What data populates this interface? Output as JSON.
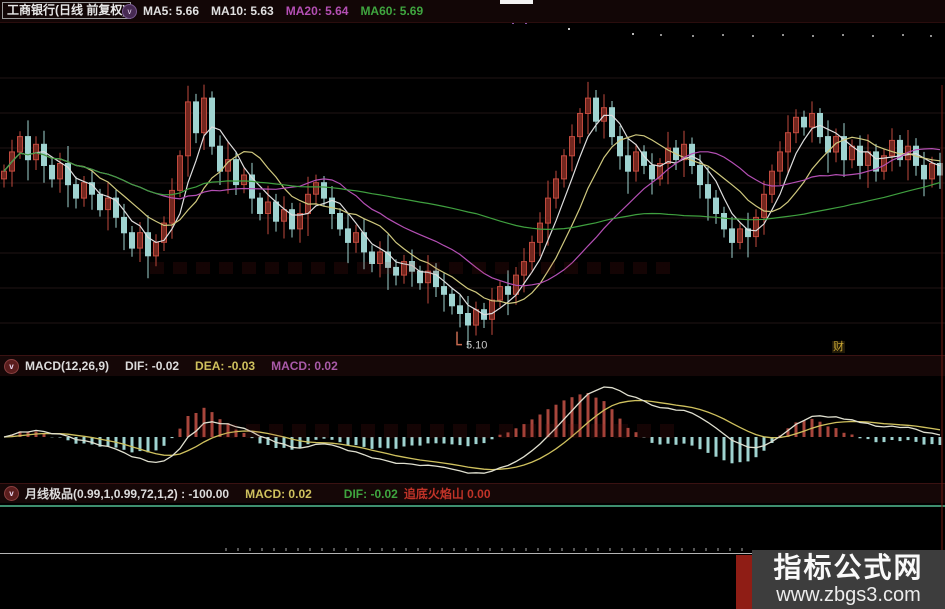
{
  "header": {
    "title": "工商银行(日线 前复权)",
    "ma5": "MA5: 5.66",
    "ma10": "MA10: 5.63",
    "ma20": "MA20: 5.64",
    "ma60": "MA60: 5.69"
  },
  "macd_panel": {
    "name": "MACD(12,26,9)",
    "dif": "DIF: -0.02",
    "dea": "DEA: -0.03",
    "macd": "MACD: 0.02"
  },
  "jx_panel": {
    "name_value": "月线极品(0.99,1,0.99,72,1,2) : -100.00",
    "macd": "MACD: 0.02",
    "dif": "DIF: -0.02",
    "alert": "追底火焰山 0.00"
  },
  "annotations": {
    "low_price_label": "5.10",
    "fin_badge": "财"
  },
  "watermark": {
    "line1": "指标公式网",
    "line2": "www.zbgs3.com"
  },
  "chart_data": {
    "type": "candlestick",
    "title": "工商银行 日线 前复权",
    "panels": [
      "price with MA5/MA10/MA20/MA60",
      "MACD(12,26,9)",
      "月线极品(0.99,1,0.99,72,1,2)"
    ],
    "ma_windows": [
      5,
      10,
      20,
      60
    ],
    "macd_params": [
      12,
      26,
      9
    ],
    "price_range": [
      4.98,
      6.55
    ],
    "low_marker_value": 5.1,
    "closes": [
      5.92,
      6.02,
      6.1,
      5.98,
      6.06,
      5.95,
      5.88,
      5.96,
      5.85,
      5.78,
      5.86,
      5.8,
      5.72,
      5.78,
      5.68,
      5.6,
      5.52,
      5.6,
      5.48,
      5.55,
      5.65,
      5.82,
      6.0,
      6.28,
      6.12,
      6.3,
      6.05,
      5.92,
      5.98,
      5.85,
      5.9,
      5.78,
      5.7,
      5.76,
      5.66,
      5.72,
      5.62,
      5.7,
      5.8,
      5.86,
      5.78,
      5.7,
      5.62,
      5.55,
      5.6,
      5.5,
      5.44,
      5.5,
      5.42,
      5.38,
      5.45,
      5.4,
      5.34,
      5.4,
      5.32,
      5.28,
      5.22,
      5.18,
      5.12,
      5.2,
      5.15,
      5.25,
      5.32,
      5.28,
      5.38,
      5.45,
      5.55,
      5.65,
      5.78,
      5.88,
      6.0,
      6.1,
      6.22,
      6.3,
      6.18,
      6.25,
      6.1,
      6.0,
      5.92,
      6.02,
      5.95,
      5.88,
      5.96,
      6.04,
      5.98,
      6.06,
      5.95,
      5.85,
      5.78,
      5.7,
      5.62,
      5.55,
      5.62,
      5.58,
      5.68,
      5.8,
      5.92,
      6.02,
      6.12,
      6.2,
      6.15,
      6.22,
      6.1,
      6.02,
      6.1,
      5.98,
      6.05,
      5.95,
      6.02,
      5.92,
      6.0,
      6.08,
      5.98,
      6.05,
      5.95,
      5.88,
      5.96,
      5.9
    ],
    "wick_amps": [
      0.05,
      0.09,
      0.04,
      0.12,
      0.06,
      0.1,
      0.05,
      0.08,
      0.13,
      0.06
    ],
    "signal_dots": [
      [
        325,
        21,
        "#c8c8c8"
      ],
      [
        333,
        21,
        "#c8c8c8"
      ],
      [
        352,
        21,
        "#c8c8c8"
      ],
      [
        358,
        21,
        "#c8c8c8"
      ],
      [
        364,
        21,
        "#c8c8c8"
      ],
      [
        370,
        21,
        "#c8c8c8"
      ],
      [
        376,
        21,
        "#c8c8c8"
      ],
      [
        391,
        21,
        "#c8c8c8"
      ],
      [
        397,
        21,
        "#c8c8c8"
      ],
      [
        419,
        21,
        "#c8c8c8"
      ],
      [
        429,
        21,
        "#c8c8c8"
      ],
      [
        452,
        21,
        "#c8c8c8"
      ],
      [
        458,
        21,
        "#c8c8c8"
      ],
      [
        469,
        21,
        "#c8c8c8"
      ],
      [
        489,
        21,
        "#c8c8c8"
      ],
      [
        495,
        21,
        "#c8c8c8"
      ],
      [
        512,
        22,
        "#8a55aa"
      ],
      [
        525,
        22,
        "#8a55aa"
      ],
      [
        568,
        28,
        "#c8c8c8"
      ],
      [
        632,
        33,
        "#b8b8b8"
      ],
      [
        660,
        34,
        "#909090"
      ],
      [
        692,
        35,
        "#909090"
      ],
      [
        722,
        34,
        "#909090"
      ],
      [
        752,
        35,
        "#909090"
      ],
      [
        782,
        34,
        "#909090"
      ],
      [
        812,
        35,
        "#909090"
      ],
      [
        842,
        34,
        "#909090"
      ],
      [
        872,
        35,
        "#909090"
      ],
      [
        902,
        34,
        "#909090"
      ],
      [
        930,
        35,
        "#909090"
      ]
    ],
    "colors": {
      "up": "#c04a3e",
      "up_fill": "#73271f",
      "down": "#9fd3d0",
      "ma5": "#dedede",
      "ma10": "#cfc87e",
      "ma20": "#b44fb4",
      "ma60": "#3f9f3f",
      "macd_pos": "#a8463c",
      "macd_neg": "#9fd3d0",
      "dif": "#e0e0d0",
      "dea": "#cfc15e",
      "flat_line": "#3e8e6e",
      "grid": "#1f1313"
    }
  }
}
